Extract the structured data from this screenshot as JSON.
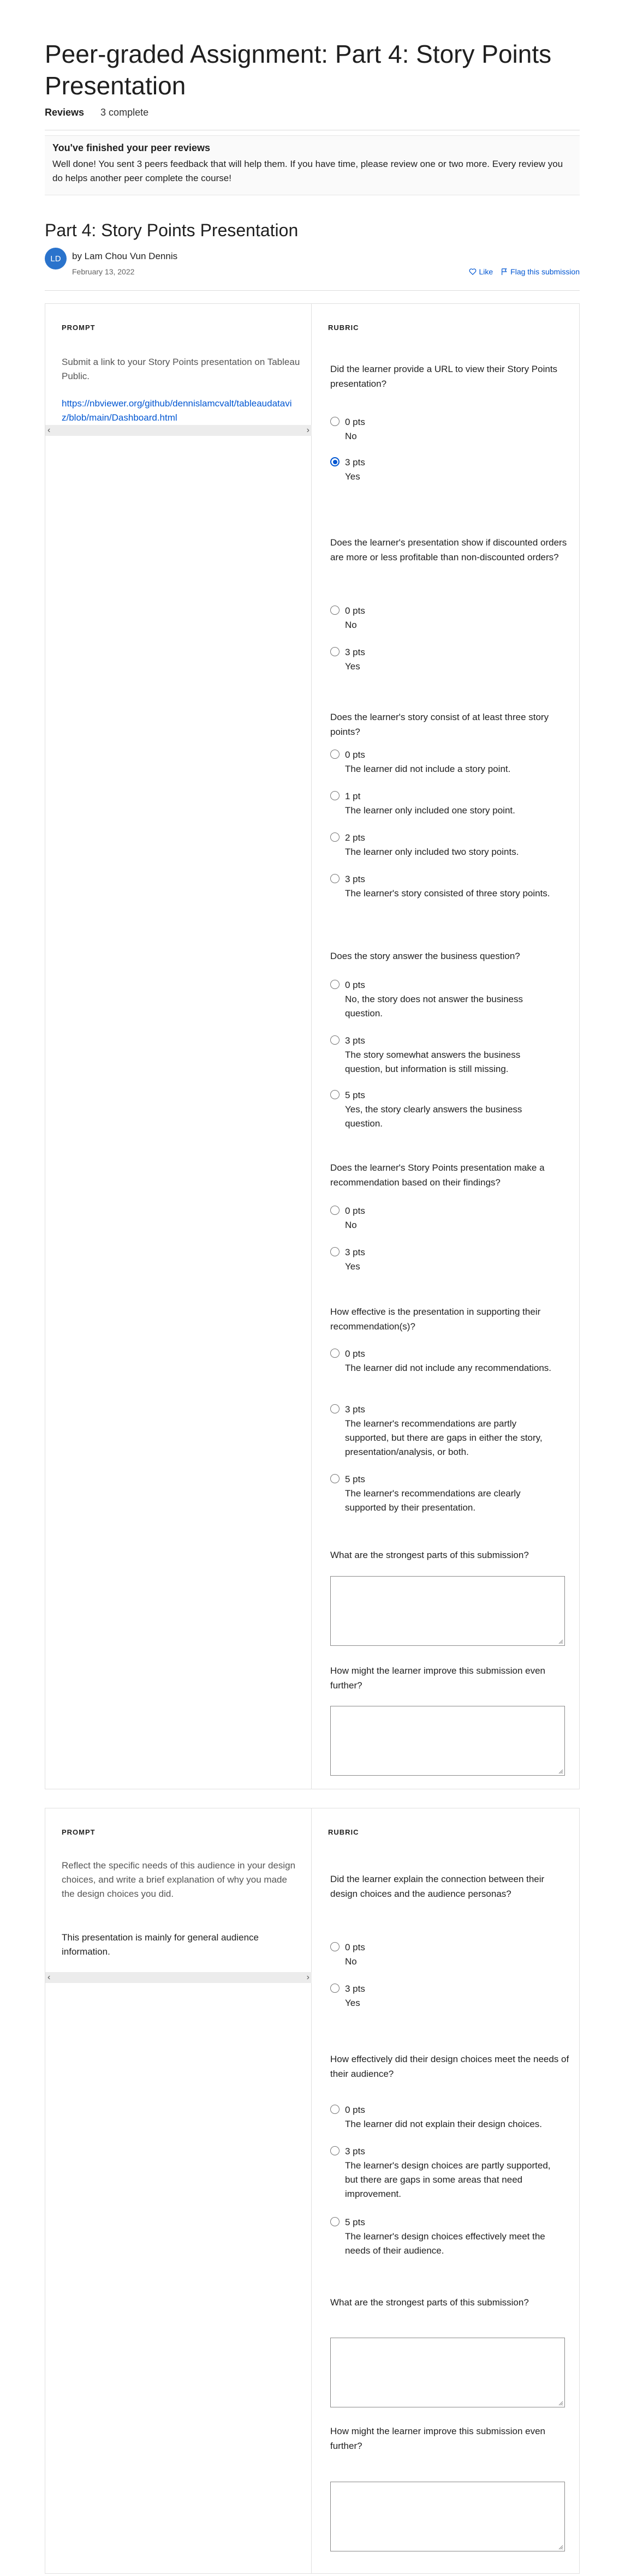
{
  "header": {
    "title": "Peer-graded Assignment: Part 4: Story Points Presentation",
    "tab_reviews": "Reviews",
    "tab_status": "3 complete"
  },
  "notice": {
    "title": "You've finished your peer reviews",
    "text": "Well done! You sent 3 peers feedback that will help them. If you have time, please review one or two more. Every review you do helps another peer complete the course!"
  },
  "submission": {
    "title": "Part 4: Story Points Presentation",
    "avatar_initials": "LD",
    "author": "by Lam Chou Vun Dennis",
    "date": "February 13, 2022",
    "like_label": "Like",
    "flag_label": "Flag this submission"
  },
  "labels": {
    "prompt": "PROMPT",
    "rubric": "RUBRIC"
  },
  "section1": {
    "prompt": "Submit a link to your Story Points presentation on Tableau Public.",
    "answer": "https://nbviewer.org/github/dennislamcvalt/tableaudataviz/blob/main/Dashboard.html",
    "questions": [
      {
        "text": "Did the learner provide a URL to view their Story Points presentation?",
        "options": [
          {
            "pts": "0 pts",
            "desc": "No",
            "checked": false
          },
          {
            "pts": "3 pts",
            "desc": "Yes",
            "checked": true
          }
        ]
      },
      {
        "text": "Does the learner's presentation show if discounted orders are more or less profitable than non-discounted orders?",
        "options": [
          {
            "pts": "0 pts",
            "desc": "No"
          },
          {
            "pts": "3 pts",
            "desc": "Yes"
          }
        ]
      },
      {
        "text": "Does the learner's story consist of at least three story points?",
        "options": [
          {
            "pts": "0 pts",
            "desc": "The learner did not include a story point."
          },
          {
            "pts": "1 pt",
            "desc": "The learner only included one story point."
          },
          {
            "pts": "2 pts",
            "desc": "The learner only included two story points."
          },
          {
            "pts": "3 pts",
            "desc": "The learner's story consisted of three story points."
          }
        ]
      },
      {
        "text": "Does the story answer the business question?",
        "options": [
          {
            "pts": "0 pts",
            "desc": "No, the story does not answer the business question."
          },
          {
            "pts": "3 pts",
            "desc": "The story somewhat answers the business question, but information is still missing."
          },
          {
            "pts": "5 pts",
            "desc": "Yes, the story clearly answers the business question."
          }
        ]
      },
      {
        "text": "Does the learner's Story Points presentation make a recommendation based on their findings?",
        "options": [
          {
            "pts": "0 pts",
            "desc": "No"
          },
          {
            "pts": "3 pts",
            "desc": "Yes"
          }
        ]
      },
      {
        "text": "How effective is the presentation in supporting their recommendation(s)?",
        "options": [
          {
            "pts": "0 pts",
            "desc": "The learner did not include any recommendations."
          },
          {
            "pts": "3 pts",
            "desc": "The learner's recommendations are partly supported, but there are gaps in either the story, presentation/analysis, or both."
          },
          {
            "pts": "5 pts",
            "desc": "The learner's recommendations are clearly supported by their presentation."
          }
        ]
      }
    ],
    "strongest_q": "What are the strongest parts of this submission?",
    "improve_q": "How might the learner improve this submission even further?"
  },
  "section2": {
    "prompt": "Reflect the specific needs of this audience in your design choices, and write a brief explanation of why you made the design choices you did.",
    "answer": "This presentation is mainly for general audience information.",
    "questions": [
      {
        "text": "Did the learner explain the connection between their design choices and the audience personas?",
        "options": [
          {
            "pts": "0 pts",
            "desc": "No"
          },
          {
            "pts": "3 pts",
            "desc": "Yes"
          }
        ]
      },
      {
        "text": "How effectively did their design choices meet the needs of their audience?",
        "options": [
          {
            "pts": "0 pts",
            "desc": "The learner did not explain their design choices."
          },
          {
            "pts": "3 pts",
            "desc": "The learner's design choices are partly supported, but there are gaps in some areas that need improvement."
          },
          {
            "pts": "5 pts",
            "desc": "The learner's design choices effectively meet the needs of their audience."
          }
        ]
      }
    ],
    "strongest_q": "What are the strongest parts of this submission?",
    "improve_q": "How might the learner improve this submission even further?"
  }
}
